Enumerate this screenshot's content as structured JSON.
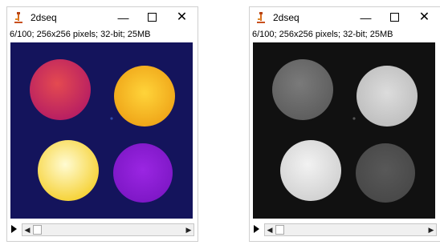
{
  "windows": [
    {
      "title": "2dseq",
      "info": "6/100; 256x256 pixels; 32-bit; 25MB",
      "lut": "fire",
      "background": "#14145c",
      "circles": [
        {
          "name": "top-left-phantom",
          "fill": "#d0305f"
        },
        {
          "name": "top-right-phantom",
          "fill": "#f4b81c"
        },
        {
          "name": "bottom-left-phantom",
          "fill": "#fff18a"
        },
        {
          "name": "bottom-right-phantom",
          "fill": "#8a1fd6"
        }
      ],
      "slice": {
        "current": 6,
        "total": 100
      }
    },
    {
      "title": "2dseq",
      "info": "6/100; 256x256 pixels; 32-bit; 25MB",
      "lut": "grays",
      "background": "#111111",
      "circles": [
        {
          "name": "top-left-phantom",
          "fill": "#6a6a6a"
        },
        {
          "name": "top-right-phantom",
          "fill": "#cfcfcf"
        },
        {
          "name": "bottom-left-phantom",
          "fill": "#e3e3e3"
        },
        {
          "name": "bottom-right-phantom",
          "fill": "#4f4f4f"
        }
      ],
      "slice": {
        "current": 6,
        "total": 100
      }
    }
  ],
  "icons": {
    "app": "imagej-microscope-icon",
    "minimize": "minimize-icon",
    "maximize": "maximize-icon",
    "close": "close-icon",
    "play": "play-icon"
  },
  "controls": {
    "minimize": "—",
    "close": "✕",
    "scroll_left": "◀",
    "scroll_right": "▶"
  }
}
